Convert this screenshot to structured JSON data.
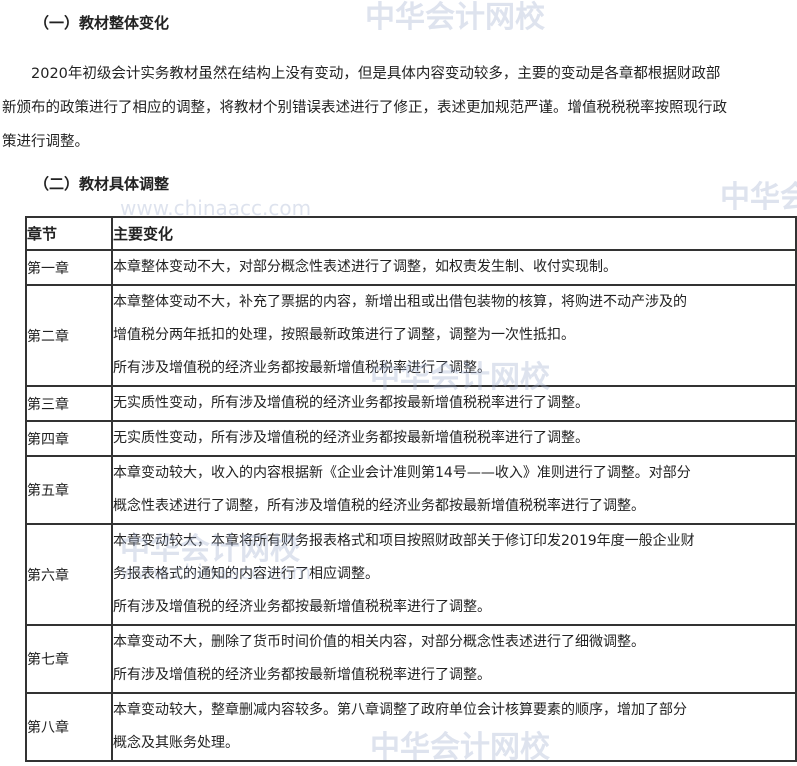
{
  "section1_title": "（一）教材整体变化",
  "section1_lines": [
    "　　2020年初级会计实务教材虽然在结构上没有变动，但是具体内容变动较多，主要的变动是各章都根据财政部",
    "新颁布的政策进行了相应的调整，将教材个别错误表述进行了修正，表述更加规范严谨。增值税税税率按照现行政",
    "策进行调整。"
  ],
  "section2_title": "（二）教材具体调整",
  "table": {
    "headers": [
      "章节",
      "主要变化"
    ],
    "rows": [
      {
        "chapter": "第一章",
        "lines": [
          "本章整体变动不大，对部分概念性表述进行了调整，如权责发生制、收付实现制。"
        ]
      },
      {
        "chapter": "第二章",
        "lines": [
          "本章整体变动不大，补充了票据的内容，新增出租或出借包装物的核算，将购进不动产涉及的",
          "增值税分两年抵扣的处理，按照最新政策进行了调整，调整为一次性抵扣。",
          "所有涉及增值税的经济业务都按最新增值税税率进行了调整。"
        ]
      },
      {
        "chapter": "第三章",
        "lines": [
          "无实质性变动，所有涉及增值税的经济业务都按最新增值税税率进行了调整。"
        ]
      },
      {
        "chapter": "第四章",
        "lines": [
          "无实质性变动，所有涉及增值税的经济业务都按最新增值税税率进行了调整。"
        ]
      },
      {
        "chapter": "第五章",
        "lines": [
          "本章变动较大，收入的内容根据新《企业会计准则第14号——收入》准则进行了调整。对部分",
          "概念性表述进行了调整，所有涉及增值税的经济业务都按最新增值税税率进行了调整。"
        ]
      },
      {
        "chapter": "第六章",
        "lines": [
          "本章变动较大，本章将所有财务报表格式和项目按照财政部关于修订印发2019年度一般企业财",
          "务报表格式的通知的内容进行了相应调整。",
          "所有涉及增值税的经济业务都按最新增值税税率进行了调整。"
        ]
      },
      {
        "chapter": "第七章",
        "lines": [
          "本章变动不大，删除了货币时间价值的相关内容，对部分概念性表述进行了细微调整。",
          "所有涉及增值税的经济业务都按最新增值税税率进行了调整。"
        ]
      },
      {
        "chapter": "第八章",
        "lines": [
          "本章变动较大，整章删减内容较多。第八章调整了政府单位会计核算要素的顺序，增加了部分",
          "概念及其账务处理。"
        ]
      }
    ]
  },
  "watermark": {
    "name": "中华会计网校",
    "url": "www.chinaacc.com"
  }
}
